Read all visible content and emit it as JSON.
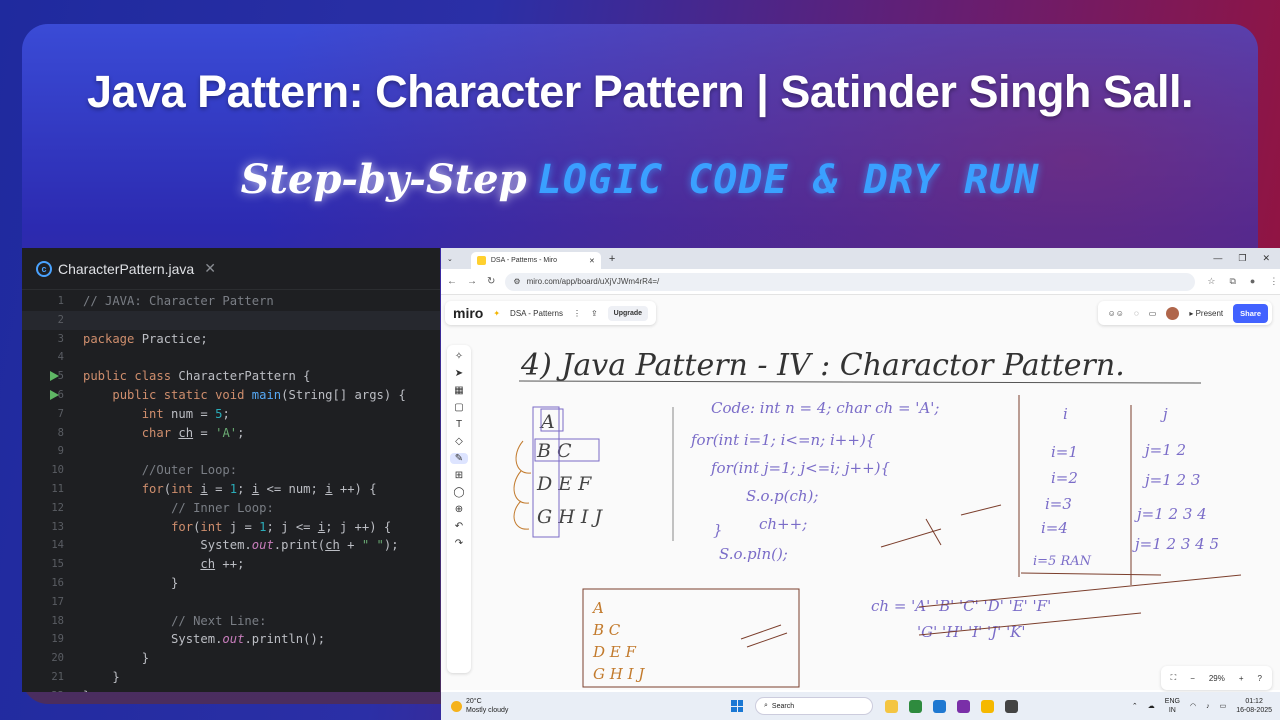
{
  "title": "Java Pattern: Character Pattern | Satinder Singh Sall.",
  "subtitle": {
    "part1": "Step-by-Step",
    "part2": "LOGIC CODE & DRY RUN"
  },
  "ide": {
    "tab_label": "CharacterPattern.java",
    "lines": [
      {
        "n": "1",
        "html": "<span class='cm'>// JAVA: Character Pattern</span>"
      },
      {
        "n": "2",
        "html": ""
      },
      {
        "n": "3",
        "html": "<span class='kw'>package</span> Practice;"
      },
      {
        "n": "4",
        "html": ""
      },
      {
        "n": "5",
        "html": "<span class='kw'>public class</span> CharacterPattern {"
      },
      {
        "n": "6",
        "html": "    <span class='kw'>public static void</span> <span class='fn'>main</span>(String[] args) {"
      },
      {
        "n": "7",
        "html": "        <span class='kw'>int</span> num = <span class='num'>5</span>;"
      },
      {
        "n": "8",
        "html": "        <span class='kw'>char</span> <span class='ul'>ch</span> = <span class='str'>'A'</span>;"
      },
      {
        "n": "9",
        "html": ""
      },
      {
        "n": "10",
        "html": "        <span class='cm'>//Outer Loop:</span>"
      },
      {
        "n": "11",
        "html": "        <span class='kw'>for</span>(<span class='kw'>int</span> <span class='ul'>i</span> = <span class='num'>1</span>; <span class='ul'>i</span> &lt;= num; <span class='ul'>i</span> ++) {"
      },
      {
        "n": "12",
        "html": "            <span class='cm'>// Inner Loop:</span>"
      },
      {
        "n": "13",
        "html": "            <span class='kw'>for</span>(<span class='kw'>int</span> j = <span class='num'>1</span>; j &lt;= <span class='ul'>i</span>; j ++) {"
      },
      {
        "n": "14",
        "html": "                System.<span class='fld'>out</span>.print(<span class='ul'>ch</span> + <span class='str'>\" \"</span>);"
      },
      {
        "n": "15",
        "html": "                <span class='ul'>ch</span> ++;"
      },
      {
        "n": "16",
        "html": "            }"
      },
      {
        "n": "17",
        "html": ""
      },
      {
        "n": "18",
        "html": "            <span class='cm'>// Next Line:</span>"
      },
      {
        "n": "19",
        "html": "            System.<span class='fld'>out</span>.println();"
      },
      {
        "n": "20",
        "html": "        }"
      },
      {
        "n": "21",
        "html": "    }"
      },
      {
        "n": "22",
        "html": "}"
      }
    ]
  },
  "browser": {
    "tab_title": "DSA - Patterns - Miro",
    "url": "miro.com/app/board/uXjVJWm4rR4=/",
    "board_name": "DSA - Patterns",
    "upgrade_label": "Upgrade",
    "present_label": "Present",
    "share_label": "Share",
    "zoom": "29%",
    "logo": "miro"
  },
  "whiteboard": {
    "heading": "4) Java Pattern - IV : Charactor Pattern.",
    "left_letters": [
      "A",
      "B C",
      "D E F",
      "G H I J"
    ],
    "code": [
      "Code:   int n = 4;   char ch = 'A';",
      "for(int i=1;  i<=n;  i++){",
      "for(int j=1;  j<=i;  j++){",
      "S.o.p(ch);",
      "ch++;",
      "}",
      "S.o.pln();"
    ],
    "table_i": [
      "i",
      "i=1",
      "i=2",
      "i=3",
      "i=4",
      "i=5 RAN"
    ],
    "table_j": [
      "j",
      "j=1 2",
      "j=1 2 3",
      "j=1 2 3 4",
      "j=1 2 3 4 5"
    ],
    "ch_row1": "ch = 'A' 'B' 'C' 'D' 'E' 'F'",
    "ch_row2": "'G' 'H'  'I'  'J' 'K'",
    "output": [
      "A",
      "B C",
      "D E F",
      "G H I J"
    ]
  },
  "taskbar": {
    "temp": "20°C",
    "weather": "Mostly cloudy",
    "search": "Search",
    "lang1": "ENG",
    "lang2": "IN",
    "time": "01:12",
    "date": "16-08-2025"
  }
}
